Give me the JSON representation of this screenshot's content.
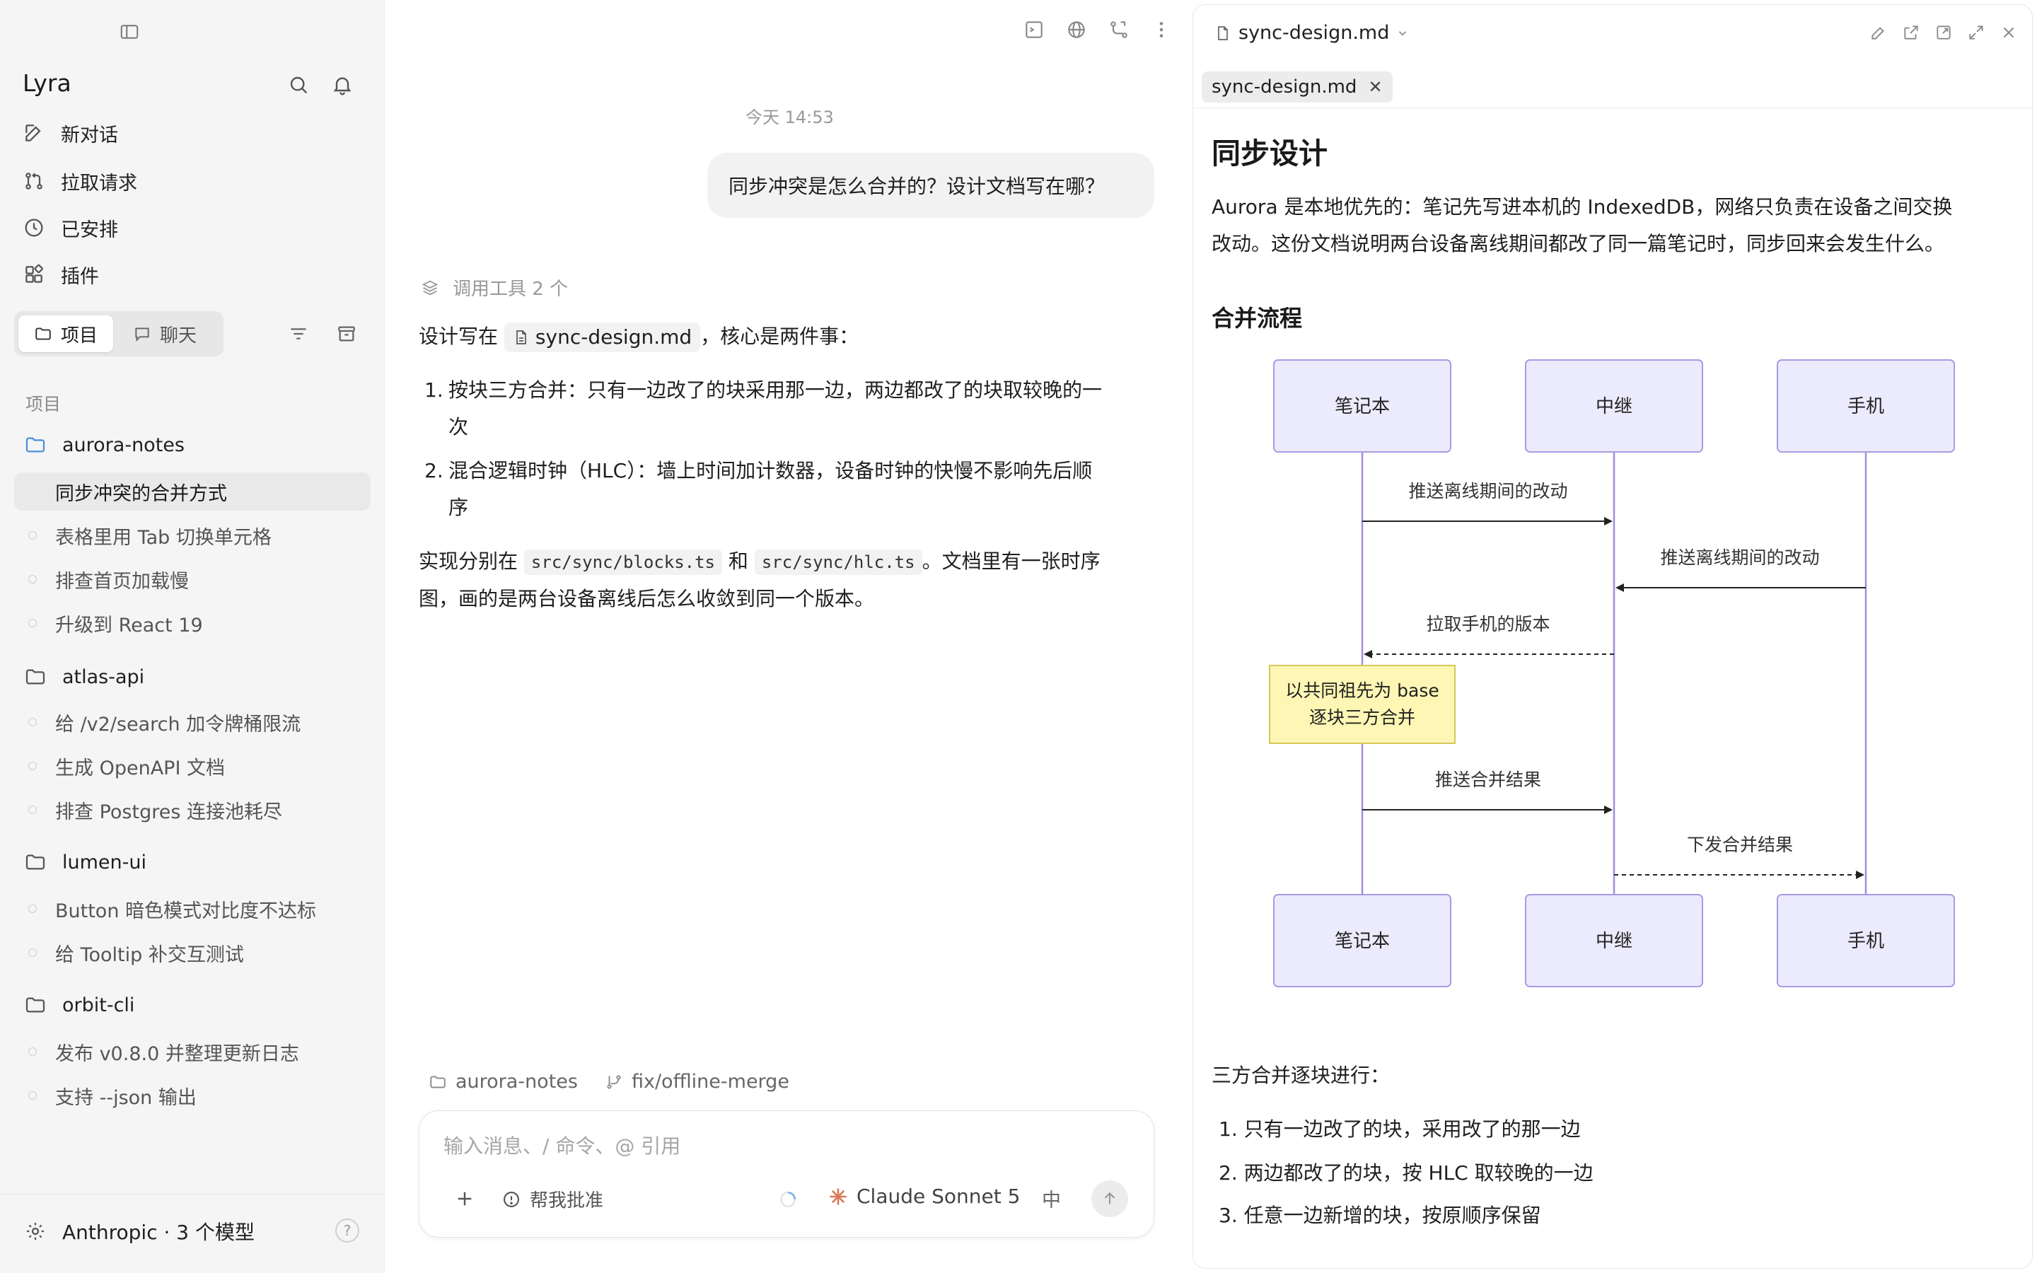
{
  "sidebar": {
    "app_title": "Lyra",
    "nav": [
      {
        "label": "新对话",
        "icon": "edit-icon"
      },
      {
        "label": "拉取请求",
        "icon": "pull-request-icon"
      },
      {
        "label": "已安排",
        "icon": "clock-icon"
      },
      {
        "label": "插件",
        "icon": "plugin-icon"
      }
    ],
    "seg_tabs": [
      {
        "label": "项目",
        "icon": "folder-icon",
        "active": true
      },
      {
        "label": "聊天",
        "icon": "chat-icon",
        "active": false
      }
    ],
    "section_label": "项目",
    "projects": [
      {
        "name": "aurora-notes",
        "threads": [
          "同步冲突的合并方式",
          "表格里用 Tab 切换单元格",
          "排查首页加载慢",
          "升级到 React 19"
        ]
      },
      {
        "name": "atlas-api",
        "threads": [
          "给 /v2/search 加令牌桶限流",
          "生成 OpenAPI 文档",
          "排查 Postgres 连接池耗尽"
        ]
      },
      {
        "name": "lumen-ui",
        "threads": [
          "Button 暗色模式对比度不达标",
          "给 Tooltip 补交互测试"
        ]
      },
      {
        "name": "orbit-cli",
        "threads": [
          "发布 v0.8.0 并整理更新日志",
          "支持 --json 输出"
        ]
      }
    ],
    "active_thread": "同步冲突的合并方式",
    "footer": {
      "label": "Anthropic · 3 个模型",
      "help": "?"
    }
  },
  "chat": {
    "timestamp": "今天 14:53",
    "user_message": "同步冲突是怎么合并的？设计文档写在哪？",
    "tools_used": "调用工具 2 个",
    "answer": {
      "intro_before": "设计写在",
      "intro_file": "sync-design.md",
      "intro_after": "，核心是两件事：",
      "items": [
        {
          "num": "1.",
          "line1": "按块三方合并：只有一边改了的块采用那一边，两边都改了的块取较晚的一",
          "line2": "次"
        },
        {
          "num": "2.",
          "line1": "混合逻辑时钟（HLC）：墙上时间加计数器，设备时钟的快慢不影响先后顺",
          "line2": "序"
        }
      ],
      "impl_before": "实现分别在",
      "impl_code1": "src/sync/blocks.ts",
      "impl_and": "和",
      "impl_code2": "src/sync/hlc.ts",
      "impl_after": "。文档里有一张时序",
      "impl_line2": "图，画的是两台设备离线后怎么收敛到同一个版本。"
    },
    "context": {
      "project": "aurora-notes",
      "branch": "fix/offline-merge"
    },
    "composer": {
      "placeholder": "输入消息、/ 命令、@ 引用",
      "value": "",
      "approve_label": "帮我批准",
      "model": "Claude Sonnet 5",
      "lang": "中"
    }
  },
  "doc": {
    "header_file": "sync-design.md",
    "tab": "sync-design.md",
    "h1": "同步设计",
    "para_line1": "Aurora 是本地优先的：笔记先写进本机的 IndexedDB，网络只负责在设备之间交换",
    "para_line2": "改动。这份文档说明两台设备离线期间都改了同一篇笔记时，同步回来会发生什么。",
    "h2": "合并流程",
    "diagram": {
      "participants": [
        "笔记本",
        "中继",
        "手机"
      ],
      "messages": [
        {
          "label": "推送离线期间的改动",
          "from": 0,
          "to": 1,
          "dashed": false
        },
        {
          "label": "推送离线期间的改动",
          "from": 2,
          "to": 1,
          "dashed": false
        },
        {
          "label": "拉取手机的版本",
          "from": 1,
          "to": 0,
          "dashed": true
        },
        {
          "label": "推送合并结果",
          "from": 0,
          "to": 1,
          "dashed": false
        },
        {
          "label": "下发合并结果",
          "from": 1,
          "to": 2,
          "dashed": true
        }
      ],
      "note_line1": "以共同祖先为 base",
      "note_line2": "逐块三方合并"
    },
    "list_title": "三方合并逐块进行：",
    "list": [
      "1. 只有一边改了的块，采用改了的那一边",
      "2. 两边都改了的块，按 HLC 取较晚的一边",
      "3. 任意一边新增的块，按原顺序保留"
    ]
  },
  "colors": {
    "lifeline": "#a58be0",
    "participant_fill": "#ecebfd",
    "participant_border": "#a99be2",
    "note_fill": "#fdf6b4",
    "note_border": "#d6c85a",
    "model_spark": "#d97757"
  }
}
